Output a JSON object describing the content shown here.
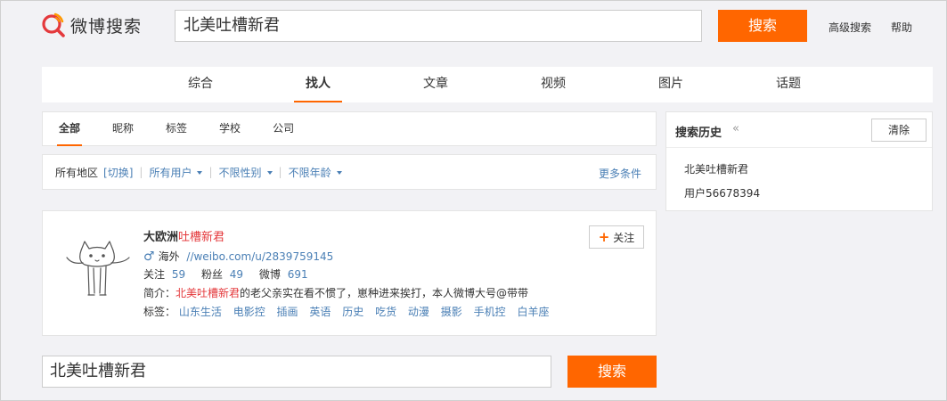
{
  "header": {
    "logo_text": "微博搜索",
    "search_value": "北美吐槽新君",
    "search_button": "搜索",
    "advanced_link": "高级搜索",
    "help_link": "帮助",
    "accent_color": "#ff6600"
  },
  "main_tabs": [
    {
      "label": "综合"
    },
    {
      "label": "找人"
    },
    {
      "label": "文章"
    },
    {
      "label": "视频"
    },
    {
      "label": "图片"
    },
    {
      "label": "话题"
    }
  ],
  "sub_tabs": [
    {
      "label": "全部"
    },
    {
      "label": "昵称"
    },
    {
      "label": "标签"
    },
    {
      "label": "学校"
    },
    {
      "label": "公司"
    }
  ],
  "filters": {
    "region": "所有地区",
    "switch": "[切换]",
    "users": "所有用户",
    "gender": "不限性别",
    "age": "不限年龄",
    "more": "更多条件"
  },
  "result": {
    "name_prefix": "大欧洲",
    "name_highlight": "吐槽新君",
    "location": "海外",
    "url": "//weibo.com/u/2839759145",
    "follow_label": "关注",
    "follow_count": "59",
    "fans_label": "粉丝",
    "fans_count": "49",
    "weibo_label": "微博",
    "weibo_count": "691",
    "intro_label": "简介：",
    "intro_highlight": "北美吐槽新君",
    "intro_rest": "的老父亲实在看不惯了，崽种进来挨打，本人微博大号@带带",
    "tags_label": "标签：",
    "tags": [
      "山东生活",
      "电影控",
      "插画",
      "英语",
      "历史",
      "吃货",
      "动漫",
      "摄影",
      "手机控",
      "白羊座"
    ],
    "follow_button": "关注"
  },
  "bottom_search": {
    "value": "北美吐槽新君",
    "button": "搜索"
  },
  "history": {
    "title": "搜索历史",
    "arrow": "«",
    "clear_button": "清除",
    "items": [
      "北美吐槽新君",
      "用户56678394"
    ]
  }
}
